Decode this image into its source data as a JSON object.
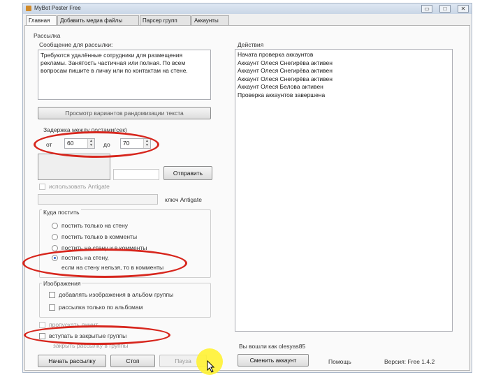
{
  "window": {
    "title": "MyBot Poster Free",
    "controls": [
      "▭",
      "□",
      "✕"
    ]
  },
  "tabs": [
    "Главная",
    "Добавить медиа файлы",
    "Парсер групп",
    "Аккаунты"
  ],
  "mailing": {
    "group_title": "Рассылка",
    "message_label": "Сообщение для рассылки:",
    "message_text": "Требуются удалённые сотрудники для размещения рекламы. Занятость частичная или полная. По всем вопросам пишите в личку или по контактам на стене.",
    "preview_button": "Просмотр вариантов рандомизации текста",
    "delay_label": "Задержка между постами(сек)",
    "from_label": "от",
    "from_value": "60",
    "to_label": "до",
    "to_value": "70",
    "send_button": "Отправить",
    "antigate_checkbox": "использовать Antigate",
    "antigate_key_label": "ключ Antigate"
  },
  "where_post": {
    "title": "Куда постить",
    "options": [
      "постить только на стену",
      "постить только в комменты",
      "постить на стену и в комменты",
      "постить на стену,",
      "если на стену нельзя, то в комменты"
    ],
    "selected_index": 3
  },
  "images": {
    "title": "Изображения",
    "option1": "добавлять изображения в альбом группы",
    "option2": "рассылка только по альбомам"
  },
  "extra": {
    "hidden_row": "пропускать лимит",
    "join_closed": "вступать в закрытые группы",
    "stop_mailing": "закрыть рассылку в группы"
  },
  "footer": {
    "start_button": "Начать рассылку",
    "stop_button": "Стоп",
    "pause_button": "Пауза",
    "logged_in": "Вы вошли как olesyas85",
    "change_account_button": "Сменить аккаунт",
    "help_link": "Помощь",
    "version": "Версия: Free 1.4.2"
  },
  "actions": {
    "title": "Действия",
    "log": [
      "Начата проверка аккаунтов",
      "Аккаунт Олеся Снегирёва активен",
      "Аккаунт Олеся Снегирёва активен",
      "Аккаунт Олеся Снегирёва активен",
      "Аккаунт Олеся Белова активен",
      "Проверка аккаунтов завершена"
    ]
  },
  "colors": {
    "highlight_oval": "#d7261d",
    "cursor_halo": "#fff233"
  }
}
